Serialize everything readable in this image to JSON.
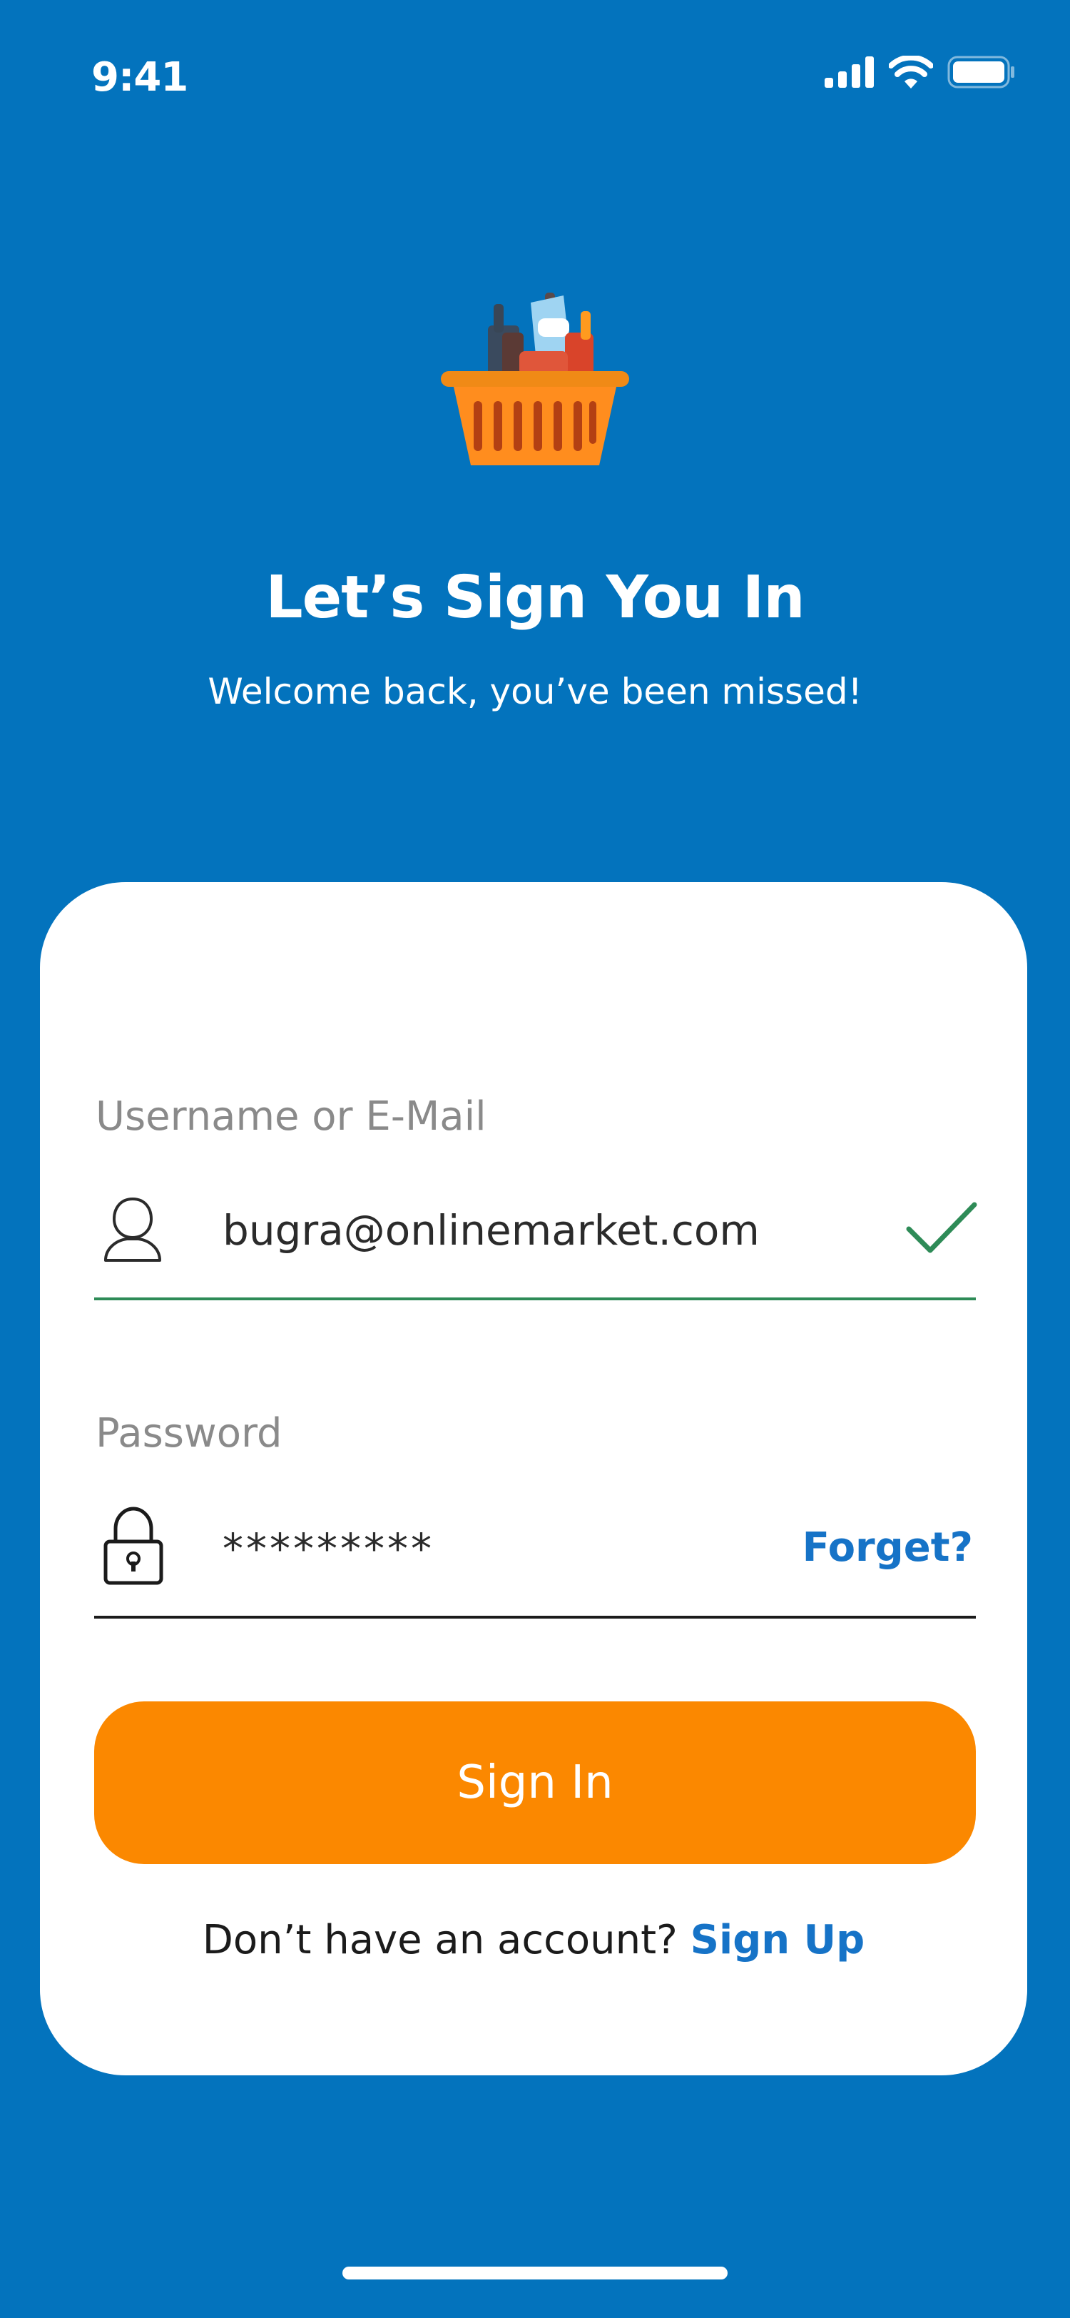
{
  "status_bar": {
    "time": "9:41",
    "icons": [
      "cellular-signal-icon",
      "wifi-icon",
      "battery-icon"
    ]
  },
  "header": {
    "logo_icon": "grocery-basket-icon",
    "title": "Let’s Sign You In",
    "subtitle": "Welcome back, you’ve been missed!"
  },
  "form": {
    "username": {
      "label": "Username or E-Mail",
      "value": "bugra@onlinemarket.com",
      "icon": "user-icon",
      "valid_icon": "checkmark-icon",
      "state": "valid"
    },
    "password": {
      "label": "Password",
      "value": "*********",
      "icon": "lock-icon",
      "forgot_label": "Forget?"
    },
    "submit_label": "Sign In",
    "signup_prompt": "Don’t have an account?",
    "signup_label": "Sign Up"
  },
  "colors": {
    "background": "#0373BD",
    "accent": "#FB8800",
    "link": "#1673C7",
    "valid": "#2E8B57"
  }
}
